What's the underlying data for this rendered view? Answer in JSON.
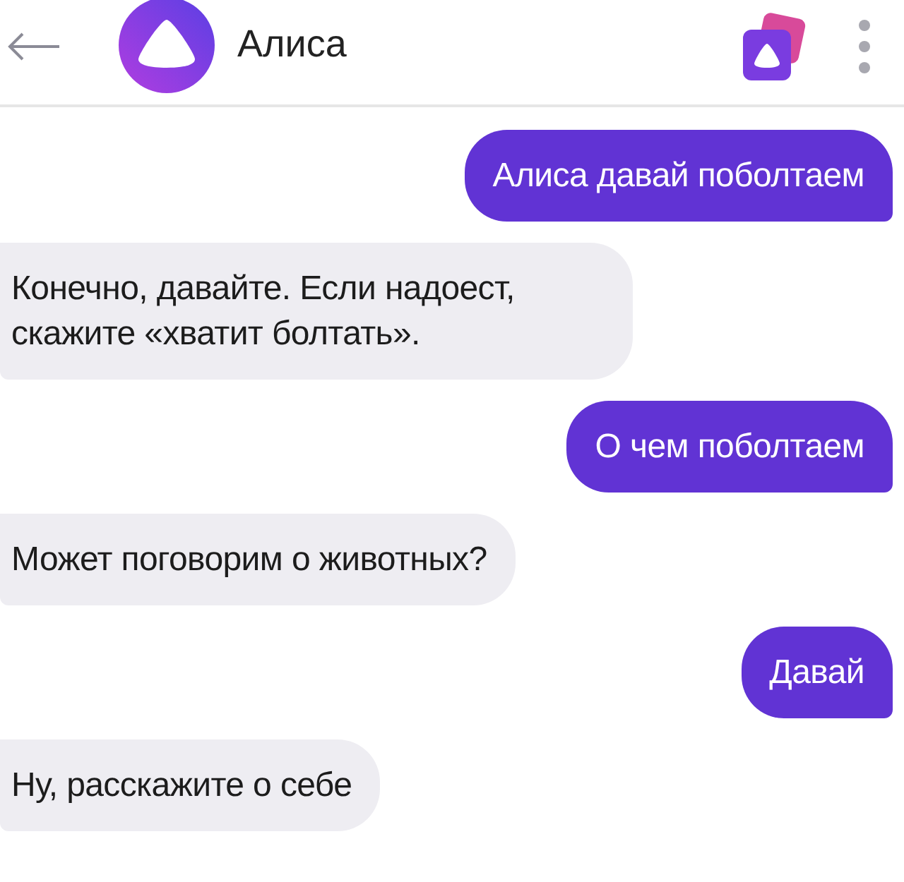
{
  "header": {
    "title": "Алиса"
  },
  "messages": [
    {
      "kind": "user",
      "text": "Алиса давай поболтаем"
    },
    {
      "kind": "assistant",
      "text": "Конечно, давайте. Если надоест, скажите «хватит болтать»."
    },
    {
      "kind": "user",
      "text": "О чем поболтаем"
    },
    {
      "kind": "assistant",
      "text": "Может поговорим о животных?"
    },
    {
      "kind": "user",
      "text": "Давай"
    },
    {
      "kind": "assistant",
      "text": "Ну, расскажите о себе"
    }
  ]
}
